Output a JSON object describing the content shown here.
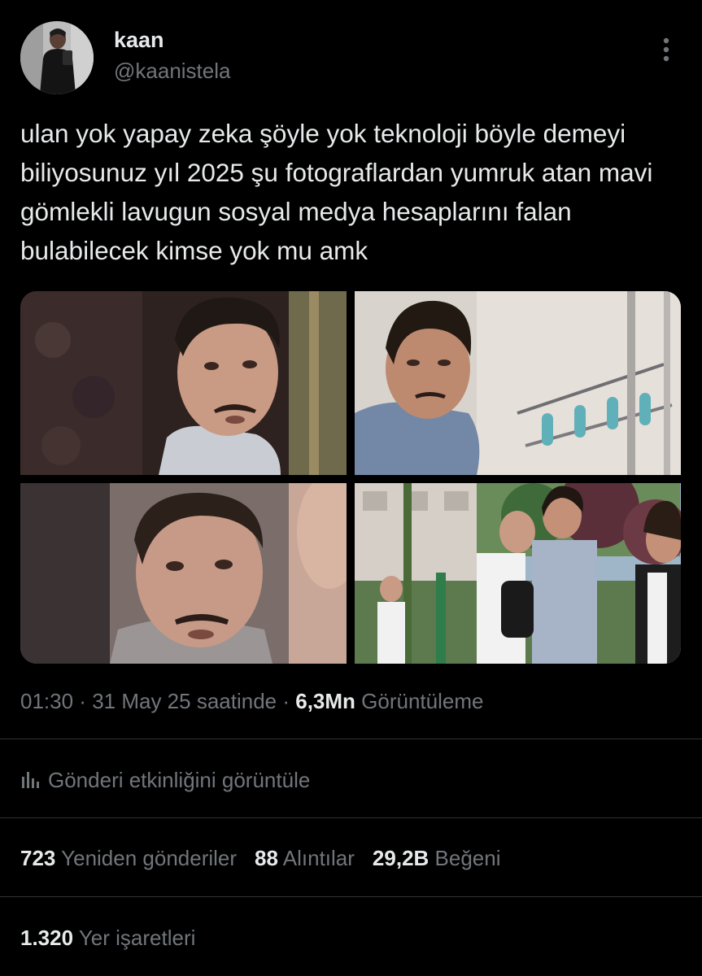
{
  "author": {
    "name": "kaan",
    "handle": "@kaanistela"
  },
  "tweet": {
    "text": "ulan yok yapay zeka şöyle yok teknoloji böyle demeyi biliyosunuz yıl 2025 şu fotograflardan yumruk atan mavi gömlekli lavugun sosyal medya hesaplarını falan bulabilecek kimse yok mu amk"
  },
  "meta": {
    "time": "01:30",
    "sep1": " · ",
    "date": "31 May 25 saatinde",
    "sep2": " · ",
    "views_count": "6,3Mn",
    "views_label": "Görüntüleme"
  },
  "activity": {
    "label": "Gönderi etkinliğini görüntüle"
  },
  "stats": {
    "reposts_count": "723",
    "reposts_label": "Yeniden gönderiler",
    "quotes_count": "88",
    "quotes_label": "Alıntılar",
    "likes_count": "29,2B",
    "likes_label": "Beğeni",
    "bookmarks_count": "1.320",
    "bookmarks_label": "Yer işaretleri"
  },
  "colors": {
    "background": "#000000",
    "text": "#e7e9ea",
    "secondary": "#71767b",
    "divider": "#2f3336"
  },
  "icons": {
    "more": "more-dots-icon",
    "activity": "bar-chart-icon"
  }
}
